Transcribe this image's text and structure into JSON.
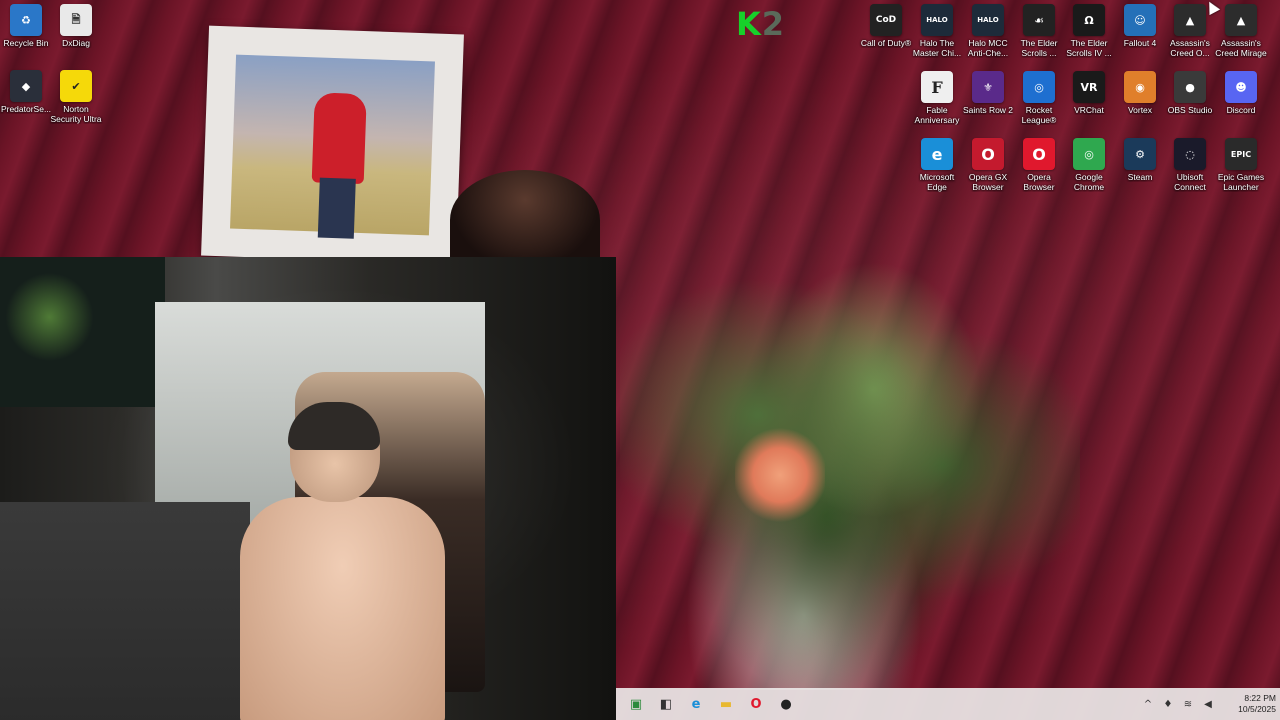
{
  "desktop_icons": [
    {
      "label": "Recycle Bin",
      "glyph": "♻",
      "bg": "#2a77c8",
      "icon": "recycle-bin-icon"
    },
    {
      "label": "DxDiag",
      "glyph": "🗎",
      "bg": "#e9e9e9",
      "icon": "document-icon"
    },
    {
      "label": "PredatorSe...",
      "glyph": "◆",
      "bg": "#2a2f3a",
      "icon": "predator-sense-icon"
    },
    {
      "label": "Norton Security Ultra",
      "glyph": "✔",
      "bg": "#f5d90a",
      "icon": "norton-icon"
    },
    {
      "label": "Call of Duty®",
      "glyph": "CoD",
      "bg": "#222222",
      "icon": "call-of-duty-icon"
    },
    {
      "label": "Halo The Master Chi...",
      "glyph": "HALO",
      "bg": "#1d2b3a",
      "icon": "halo-icon"
    },
    {
      "label": "Halo MCC Anti-Che...",
      "glyph": "HALO",
      "bg": "#1d2b3a",
      "icon": "halo-anticheat-icon"
    },
    {
      "label": "The Elder Scrolls ...",
      "glyph": "☙",
      "bg": "#222222",
      "icon": "skyrim-icon"
    },
    {
      "label": "The Elder Scrolls IV ...",
      "glyph": "Ω",
      "bg": "#1a1a1a",
      "icon": "oblivion-icon"
    },
    {
      "label": "Fallout 4",
      "glyph": "☺",
      "bg": "#2470b8",
      "icon": "fallout-icon"
    },
    {
      "label": "Assassin's Creed O...",
      "glyph": "▲",
      "bg": "#2c2c2c",
      "icon": "assassins-creed-icon"
    },
    {
      "label": "Assassin's Creed Mirage",
      "glyph": "▲",
      "bg": "#2c2c2c",
      "icon": "assassins-creed-mirage-icon"
    },
    {
      "label": "Fable Anniversary",
      "glyph": "F",
      "bg": "#efefef",
      "icon": "fable-icon"
    },
    {
      "label": "Saints Row 2",
      "glyph": "⚜",
      "bg": "#5a2a8a",
      "icon": "saints-row-icon"
    },
    {
      "label": "Rocket League®",
      "glyph": "◎",
      "bg": "#1e6fd0",
      "icon": "rocket-league-icon"
    },
    {
      "label": "VRChat",
      "glyph": "VR",
      "bg": "#1a1a1a",
      "icon": "vrchat-icon"
    },
    {
      "label": "Vortex",
      "glyph": "◉",
      "bg": "#e07f2b",
      "icon": "vortex-icon"
    },
    {
      "label": "OBS Studio",
      "glyph": "●",
      "bg": "#3a3a3a",
      "icon": "obs-icon"
    },
    {
      "label": "Discord",
      "glyph": "☻",
      "bg": "#5865f2",
      "icon": "discord-icon"
    },
    {
      "label": "Microsoft Edge",
      "glyph": "e",
      "bg": "#1a8fd8",
      "icon": "edge-icon"
    },
    {
      "label": "Opera GX Browser",
      "glyph": "O",
      "bg": "#c41a2e",
      "icon": "opera-gx-icon"
    },
    {
      "label": "Opera Browser",
      "glyph": "O",
      "bg": "#e0182d",
      "icon": "opera-icon"
    },
    {
      "label": "Google Chrome",
      "glyph": "◎",
      "bg": "#2fa84f",
      "icon": "chrome-icon"
    },
    {
      "label": "Steam",
      "glyph": "⚙",
      "bg": "#1b3a5a",
      "icon": "steam-icon"
    },
    {
      "label": "Ubisoft Connect",
      "glyph": "◌",
      "bg": "#1a1a2a",
      "icon": "ubisoft-icon"
    },
    {
      "label": "Epic Games Launcher",
      "glyph": "EPIC",
      "bg": "#2a2a2a",
      "icon": "epic-games-icon"
    }
  ],
  "overlay_logo": {
    "k": "K",
    "n": "2"
  },
  "taskbar": {
    "buttons": [
      {
        "icon": "taskbar-app-icon",
        "glyph": "▣",
        "color": "#2a8a3a"
      },
      {
        "icon": "task-view-icon",
        "glyph": "◧",
        "color": "#333333"
      },
      {
        "icon": "edge-icon",
        "glyph": "e",
        "color": "#1a8fd8"
      },
      {
        "icon": "file-explorer-icon",
        "glyph": "▬",
        "color": "#e8b830"
      },
      {
        "icon": "opera-icon",
        "glyph": "O",
        "color": "#e0182d"
      },
      {
        "icon": "obs-icon",
        "glyph": "●",
        "color": "#222222"
      }
    ],
    "tray": {
      "chevron": "^",
      "mic": "♦",
      "wifi": "≋",
      "volume": "◀"
    },
    "time": "8:22 PM",
    "date": "10/5/2025"
  }
}
